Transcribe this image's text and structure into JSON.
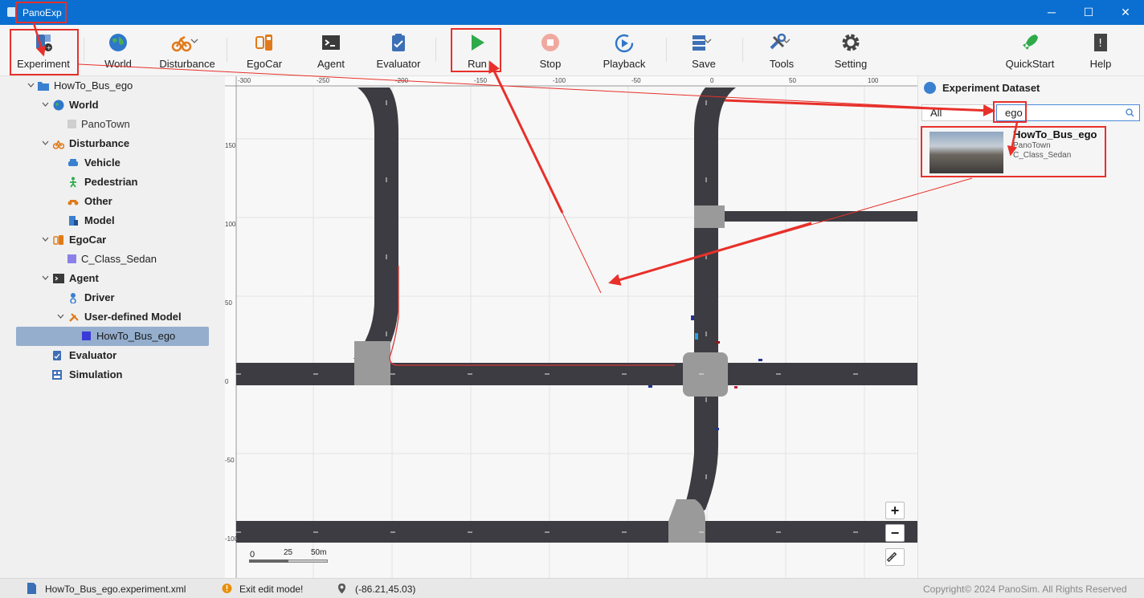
{
  "window": {
    "title": "PanoExp",
    "minimize": "─",
    "maximize": "☐",
    "close": "✕"
  },
  "toolbar": {
    "experiment": "Experiment",
    "world": "World",
    "disturbance": "Disturbance",
    "egocar": "EgoCar",
    "agent": "Agent",
    "evaluator": "Evaluator",
    "run": "Run",
    "stop": "Stop",
    "playback": "Playback",
    "save": "Save",
    "tools": "Tools",
    "setting": "Setting",
    "quickstart": "QuickStart",
    "help": "Help"
  },
  "tree": {
    "root": "HowTo_Bus_ego",
    "world": "World",
    "panotown": "PanoTown",
    "disturbance": "Disturbance",
    "vehicle": "Vehicle",
    "pedestrian": "Pedestrian",
    "other": "Other",
    "model": "Model",
    "egocar": "EgoCar",
    "sedan": "C_Class_Sedan",
    "agent": "Agent",
    "driver": "Driver",
    "user_model": "User-defined Model",
    "bus_ego": "HowTo_Bus_ego",
    "evaluator": "Evaluator",
    "simulation": "Simulation"
  },
  "map": {
    "x_ticks": [
      "-300",
      "-250",
      "-200",
      "-150",
      "-100",
      "-50",
      "0",
      "50",
      "100"
    ],
    "y_ticks": [
      "150",
      "100",
      "50",
      "0",
      "-50",
      "-100"
    ],
    "scale": {
      "zero": "0",
      "mid": "25",
      "end": "50m"
    },
    "zoom_in": "+",
    "zoom_out": "−"
  },
  "dataset": {
    "title": "Experiment Dataset",
    "filter": "All",
    "search_value": "ego",
    "card": {
      "name": "HowTo_Bus_ego",
      "world": "PanoTown",
      "car": "C_Class_Sedan"
    }
  },
  "status": {
    "file": "HowTo_Bus_ego.experiment.xml",
    "mode": "Exit edit mode!",
    "coords": "(-86.21,45.03)",
    "copyright": "Copyright© 2024 PanoSim. All Rights Reserved"
  },
  "colors": {
    "titlebar": "#0a6fd0",
    "road": "#3c3c42",
    "annotation": "#e8302a",
    "selected": "#95aece"
  }
}
